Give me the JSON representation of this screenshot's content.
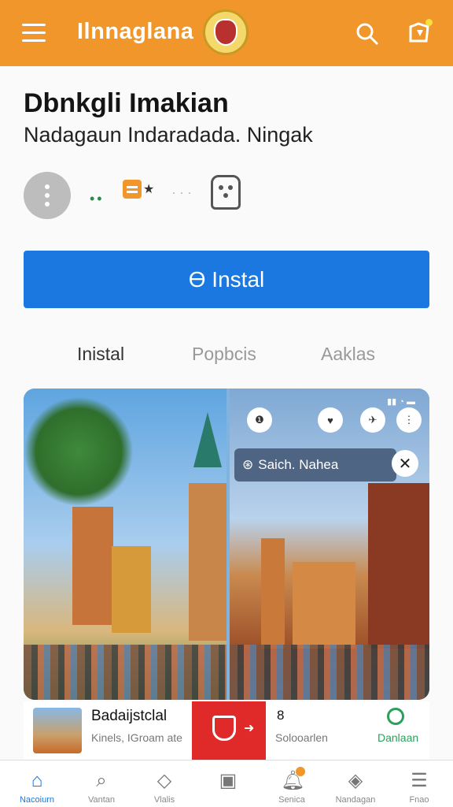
{
  "topbar": {
    "title": "Ilnnaglana",
    "icons": [
      "menu-icon",
      "emblem-logo",
      "search-icon",
      "profile-icon"
    ],
    "color": "#f0962a"
  },
  "app": {
    "name": "Dbnkgli Imakian",
    "subtitle": "Nadagaun Indaradada. Ningak",
    "meta_icons": [
      "more-icon",
      "rating-dots",
      "badge-icon",
      "star-icon",
      "robot-icon"
    ]
  },
  "install_button": {
    "label": "ϴ Instal",
    "color": "#1a78e0"
  },
  "tabs": [
    {
      "label": "Inistal",
      "active": true
    },
    {
      "label": "Popbcis",
      "active": false
    },
    {
      "label": "Aaklas",
      "active": false
    }
  ],
  "gallery": {
    "overlay_label": "Saich. Nahea",
    "overlay_icons": [
      "badge-icon",
      "heart-icon",
      "pin-icon",
      "more-icon",
      "close-icon",
      "refresh-icon"
    ]
  },
  "bottom_strip": {
    "title": "Badaijstclal",
    "subtitle": "Kinels, IGroam ate",
    "count": "8",
    "count_sub": "Solooarlen",
    "action": "Danlaan"
  },
  "bottom_nav": [
    {
      "label": "Nacoiurn",
      "icon": "home-icon",
      "active": true
    },
    {
      "label": "Vantan",
      "icon": "search-icon",
      "active": false
    },
    {
      "label": "Vlalis",
      "icon": "diamond-icon",
      "active": false
    },
    {
      "label": "",
      "icon": "clipboard-icon",
      "active": false
    },
    {
      "label": "Senica",
      "icon": "bell-icon",
      "active": false,
      "badge": true
    },
    {
      "label": "Nandagan",
      "icon": "compass-icon",
      "active": false
    },
    {
      "label": "Fnao",
      "icon": "menu-lines-icon",
      "active": false
    }
  ]
}
